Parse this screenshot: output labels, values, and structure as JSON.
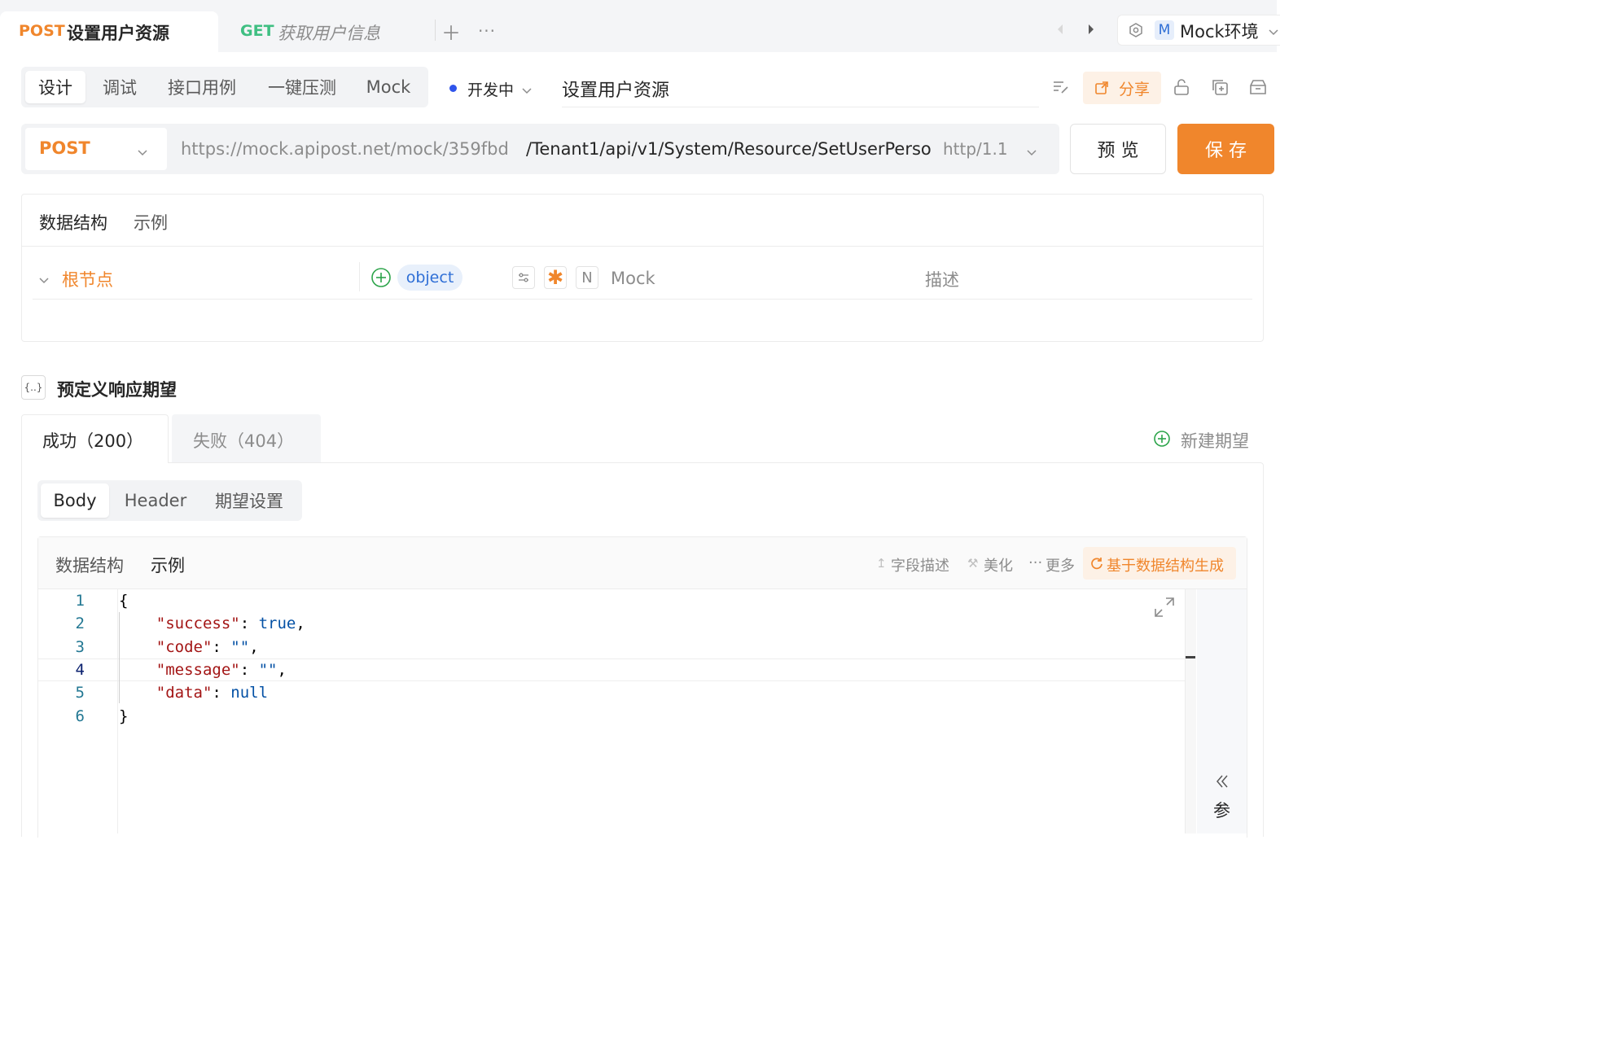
{
  "tabs": [
    {
      "method": "POST",
      "title": "设置用户资源",
      "active": true
    },
    {
      "method": "GET",
      "title": "获取用户信息",
      "active": false
    }
  ],
  "env": {
    "badge": "M",
    "name": "Mock环境"
  },
  "modes": [
    "设计",
    "调试",
    "接口用例",
    "一键压测",
    "Mock"
  ],
  "status": "开发中",
  "api_name": "设置用户资源",
  "share_label": "分享",
  "request": {
    "method": "POST",
    "base_url": "https://mock.apipost.net/mock/359fbd",
    "path": "/Tenant1/api/v1/System/Resource/SetUserPerso",
    "protocol": "http/1.1",
    "preview_label": "预 览",
    "save_label": "保 存"
  },
  "schema_panel": {
    "tabs": [
      "数据结构",
      "示例"
    ],
    "root_label": "根节点",
    "type": "object",
    "mock_placeholder": "Mock",
    "desc_placeholder": "描述",
    "n_label": "N"
  },
  "expectations": {
    "icon_text": "{..}",
    "title": "预定义响应期望",
    "tabs": [
      "成功（200）",
      "失败（404）"
    ],
    "new_label": "新建期望",
    "sub_tabs": [
      "Body",
      "Header",
      "期望设置"
    ],
    "editor_tabs": [
      "数据结构",
      "示例"
    ],
    "actions": {
      "field_desc": "字段描述",
      "beautify": "美化",
      "more": "更多",
      "generate": "基于数据结构生成"
    },
    "side_label": "参",
    "code_lines": [
      "1",
      "2",
      "3",
      "4",
      "5",
      "6"
    ]
  },
  "colors": {
    "orange": "#f0862c",
    "get_green": "#3fbf82",
    "blue": "#2f6fd6",
    "green": "#2ca44a"
  }
}
